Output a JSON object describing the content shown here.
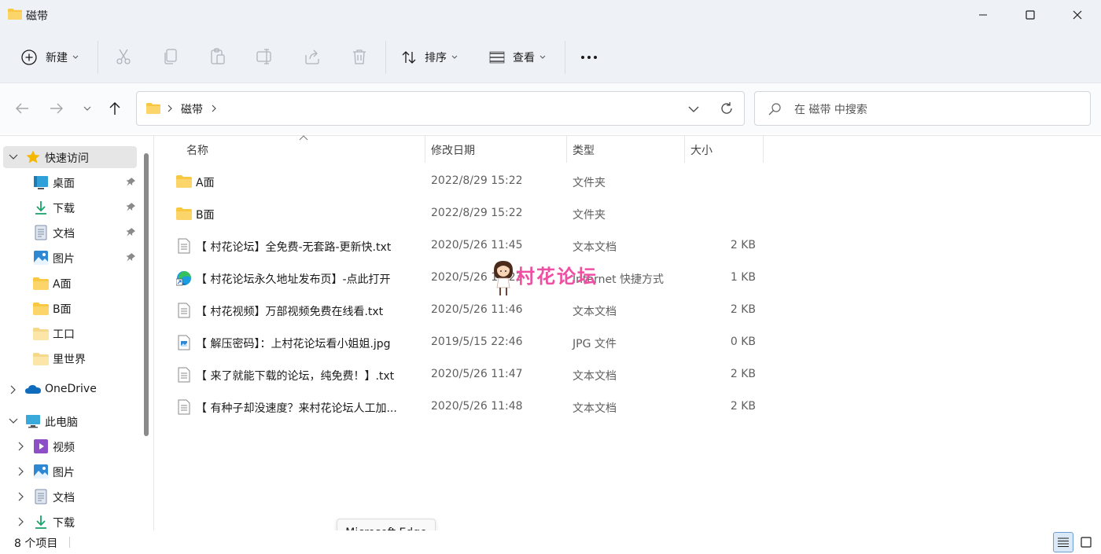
{
  "window": {
    "title": "磁带"
  },
  "toolbar": {
    "new_label": "新建",
    "sort_label": "排序",
    "view_label": "查看",
    "more_label": "•••"
  },
  "address": {
    "path": "磁带"
  },
  "search": {
    "placeholder": "在 磁带 中搜索"
  },
  "sidebar": {
    "quick_access": "快速访问",
    "pinned": [
      {
        "label": "桌面",
        "icon": "desktop-icon"
      },
      {
        "label": "下载",
        "icon": "download-icon"
      },
      {
        "label": "文档",
        "icon": "document-icon"
      },
      {
        "label": "图片",
        "icon": "pictures-icon"
      }
    ],
    "folders": [
      {
        "label": "A面"
      },
      {
        "label": "B面"
      },
      {
        "label": "工口"
      },
      {
        "label": "里世界"
      }
    ],
    "onedrive": "OneDrive",
    "this_pc": "此电脑",
    "pc_items": [
      {
        "label": "视频",
        "icon": "videos-icon"
      },
      {
        "label": "图片",
        "icon": "pictures-icon"
      },
      {
        "label": "文档",
        "icon": "document-icon"
      },
      {
        "label": "下载",
        "icon": "download-icon"
      }
    ]
  },
  "columns": {
    "name": "名称",
    "date": "修改日期",
    "type": "类型",
    "size": "大小"
  },
  "files": [
    {
      "name": "A面",
      "date": "2022/8/29 15:22",
      "type": "文件夹",
      "size": "",
      "icon": "folder-icon"
    },
    {
      "name": "B面",
      "date": "2022/8/29 15:22",
      "type": "文件夹",
      "size": "",
      "icon": "folder-icon"
    },
    {
      "name": "【 村花论坛】全免费-无套路-更新快.txt",
      "date": "2020/5/26 11:45",
      "type": "文本文档",
      "size": "2 KB",
      "icon": "text-file-icon"
    },
    {
      "name": "【 村花论坛永久地址发布页】-点此打开",
      "date": "2020/5/26 11:23",
      "type": "Internet 快捷方式",
      "size": "1 KB",
      "icon": "edge-shortcut-icon"
    },
    {
      "name": "【 村花视频】万部视频免费在线看.txt",
      "date": "2020/5/26 11:46",
      "type": "文本文档",
      "size": "2 KB",
      "icon": "text-file-icon"
    },
    {
      "name": "【 解压密码】：上村花论坛看小姐姐.jpg",
      "date": "2019/5/15 22:46",
      "type": "JPG 文件",
      "size": "0 KB",
      "icon": "image-file-icon"
    },
    {
      "name": "【 来了就能下载的论坛，纯免费！】.txt",
      "date": "2020/5/26 11:47",
      "type": "文本文档",
      "size": "2 KB",
      "icon": "text-file-icon"
    },
    {
      "name": "【 有种子却没速度？来村花论坛人工加...",
      "date": "2020/5/26 11:48",
      "type": "文本文档",
      "size": "2 KB",
      "icon": "text-file-icon"
    }
  ],
  "watermark": {
    "text": "村花论坛"
  },
  "tooltip": {
    "text": "Microsoft Edge"
  },
  "status": {
    "count": "8 个项目"
  },
  "colors": {
    "accent": "#0067c0",
    "folder": "#f8c843",
    "watermark": "#ef4fa3"
  }
}
